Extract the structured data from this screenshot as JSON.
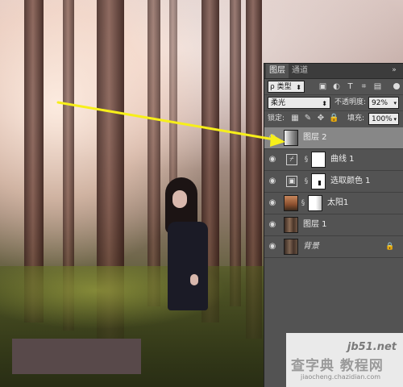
{
  "panel": {
    "tabs": [
      "图层",
      "通道"
    ],
    "collapse_glyph": "»",
    "menu_glyph": "≡",
    "filter": {
      "label": "ρ 类型",
      "caret": "⬍"
    },
    "filter_icons": [
      "▣",
      "◐",
      "T",
      "⌗",
      "▤"
    ],
    "blend_mode": "柔光",
    "blend_caret": "⬍",
    "opacity_label": "不透明度:",
    "opacity_value": "92%",
    "lock_label": "锁定:",
    "lock_icons": [
      "▦",
      "✎",
      "✥",
      "🔒"
    ],
    "fill_label": "填充:",
    "fill_value": "100%",
    "value_caret": "▾",
    "eye_glyph": "◉",
    "chain_glyph": "§",
    "layers": [
      {
        "name": "图层 2",
        "selected": true
      },
      {
        "name": "曲线 1",
        "adjust_icon": "⌿"
      },
      {
        "name": "选取颜色 1",
        "adjust_icon": "▣"
      },
      {
        "name": "太阳1"
      },
      {
        "name": "图层 1"
      },
      {
        "name": "背景",
        "italic": true,
        "lock": "🔒"
      }
    ]
  },
  "watermark": {
    "site": "jb51.net",
    "cn": "查字典 教程网",
    "url": "jiaocheng.chazidian.com"
  },
  "colors": {
    "arrow": "#f7ef1a",
    "panel_bg": "#535353",
    "selected_row": "#878787"
  }
}
